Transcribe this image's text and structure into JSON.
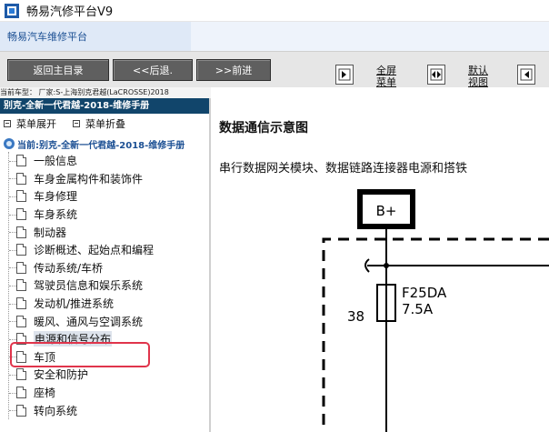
{
  "window": {
    "title": "畅易汽修平台V9"
  },
  "header": {
    "title": "畅易汽车维修平台"
  },
  "toolbar": {
    "back_home": "返回主目录",
    "back": "<<后退.",
    "forward": ">>前进",
    "fullscreen_line1": "全屏",
    "fullscreen_line2": "菜单",
    "default_line1": "默认",
    "default_line2": "视图"
  },
  "car_info": "当前车型： 厂家:S-上海别克君越(LaCROSSE)2018",
  "sidebar": {
    "manual_title": "别克-全新一代君越-2018-维修手册",
    "expand_label": "菜单展开",
    "collapse_label": "菜单折叠",
    "root_label": "当前:别克-全新一代君越-2018-维修手册",
    "items": [
      {
        "label": "一般信息"
      },
      {
        "label": "车身金属构件和装饰件"
      },
      {
        "label": "车身修理"
      },
      {
        "label": "车身系统"
      },
      {
        "label": "制动器"
      },
      {
        "label": "诊断概述、起始点和编程"
      },
      {
        "label": "传动系统/车桥"
      },
      {
        "label": "驾驶员信息和娱乐系统"
      },
      {
        "label": "发动机/推进系统"
      },
      {
        "label": "暖风、通风与空调系统"
      },
      {
        "label": "电源和信号分布"
      },
      {
        "label": "车顶"
      },
      {
        "label": "安全和防护"
      },
      {
        "label": "座椅"
      },
      {
        "label": "转向系统"
      }
    ],
    "selected_index": 10
  },
  "content": {
    "title": "数据通信示意图",
    "subtitle": "串行数据网关模块、数据链路连接器电源和搭铁",
    "diagram": {
      "power_label": "B+",
      "fuse_name": "F25DA",
      "fuse_rating": "7.5A",
      "pin_number": "38"
    }
  },
  "colors": {
    "manual_title_bg": "#11456b",
    "nav_button_bg": "#5f5f5f",
    "highlight": "#e0344b",
    "link_blue": "#1b4f93"
  }
}
